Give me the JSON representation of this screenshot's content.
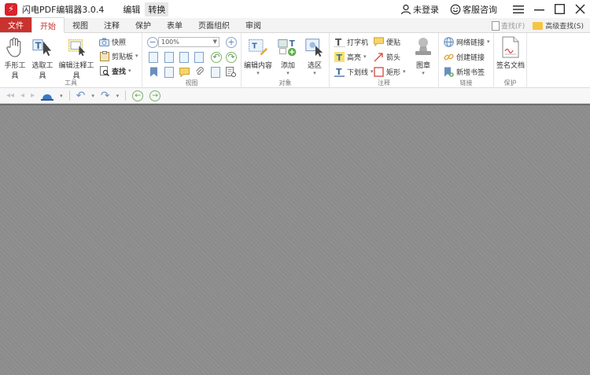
{
  "title_bar": {
    "app_logo_glyph": "⚡",
    "app_title": "闪电PDF编辑器3.0.4",
    "menu": [
      "编辑",
      "转换"
    ],
    "user_label": "未登录",
    "service_label": "客服咨询"
  },
  "tabs": {
    "file": "文件",
    "items": [
      "开始",
      "视图",
      "注释",
      "保护",
      "表单",
      "页面组织",
      "审阅"
    ],
    "active_index": 0
  },
  "search": {
    "find_label": "查找(F)",
    "advanced_label": "高级查找(S)"
  },
  "ribbon": {
    "tools": {
      "label": "工具",
      "hand": "手形工具",
      "select": "选取工具",
      "annotate_edit": "编辑注释工具",
      "snapshot": "快照",
      "clipboard": "剪贴板",
      "find": "查找"
    },
    "view": {
      "label": "视图",
      "zoom_value": "100%"
    },
    "object": {
      "label": "对象",
      "edit_content": "编辑内容",
      "add": "添加",
      "select_area": "选区"
    },
    "annotate": {
      "label": "注释",
      "typewriter": "打字机",
      "note": "便贴",
      "highlight": "高亮",
      "arrow": "箭头",
      "underline": "下划线",
      "rectangle": "矩形",
      "stamp": "图章"
    },
    "links": {
      "label": "链接",
      "web_link": "网络链接",
      "create_link": "创建链接",
      "new_bookmark": "新增书签"
    },
    "protect": {
      "label": "保护",
      "sign": "签名文档"
    }
  },
  "colors": {
    "accent": "#c8322f",
    "doc_bg": "#8e8e8e",
    "icon_blue": "#5b7fa9"
  }
}
